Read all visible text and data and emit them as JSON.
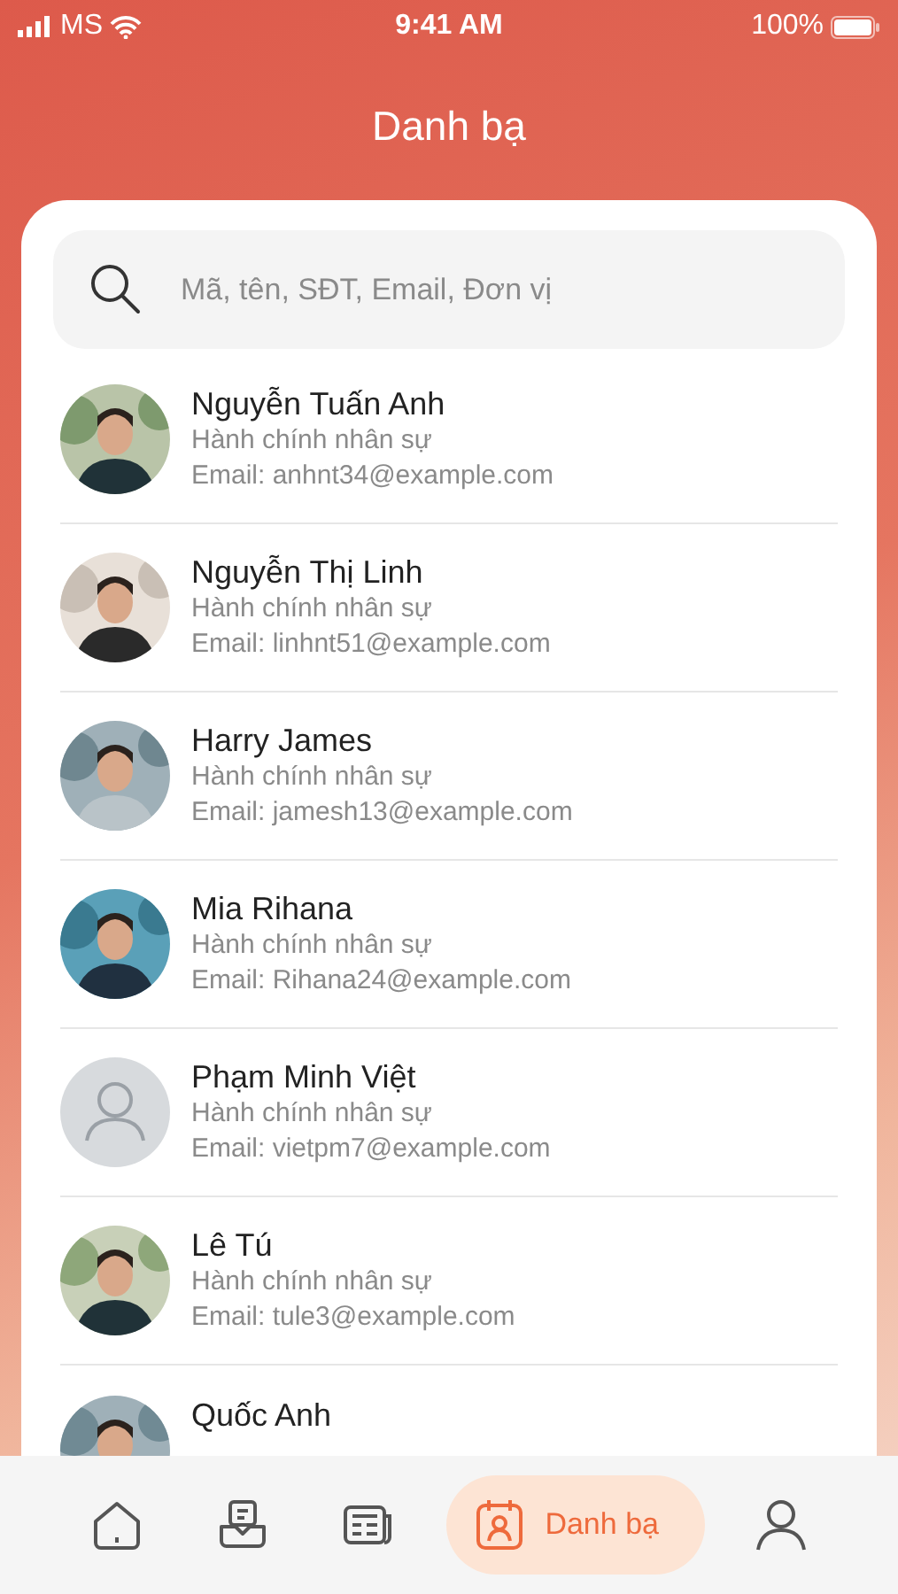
{
  "status_bar": {
    "carrier": "MS",
    "time": "9:41 AM",
    "battery": "100%"
  },
  "title": "Danh bạ",
  "search": {
    "placeholder": "Mã, tên, SĐT, Email, Đơn vị"
  },
  "contacts": [
    {
      "name": "Nguyễn Tuấn Anh",
      "department": "Hành chính nhân sự",
      "email": "Email: anhnt34@example.com"
    },
    {
      "name": "Nguyễn Thị Linh",
      "department": "Hành chính nhân sự",
      "email": "Email: linhnt51@example.com"
    },
    {
      "name": "Harry James",
      "department": "Hành chính nhân sự",
      "email": "Email: jamesh13@example.com"
    },
    {
      "name": "Mia Rihana",
      "department": "Hành chính nhân sự",
      "email": "Email: Rihana24@example.com"
    },
    {
      "name": "Phạm Minh Việt",
      "department": "Hành chính nhân sự",
      "email": "Email: vietpm7@example.com",
      "avatar": {
        "kind": "placeholder"
      }
    },
    {
      "name": "Lê Tú",
      "department": "Hành chính nhân sự",
      "email": "Email: tule3@example.com"
    },
    {
      "name": "Quốc Anh"
    }
  ],
  "nav": [
    {
      "kind": "home",
      "selected": false
    },
    {
      "kind": "inbox",
      "selected": false
    },
    {
      "kind": "news",
      "selected": false
    },
    {
      "kind": "contacts",
      "label": "Danh bạ",
      "selected": true
    },
    {
      "kind": "profile",
      "selected": false
    }
  ]
}
